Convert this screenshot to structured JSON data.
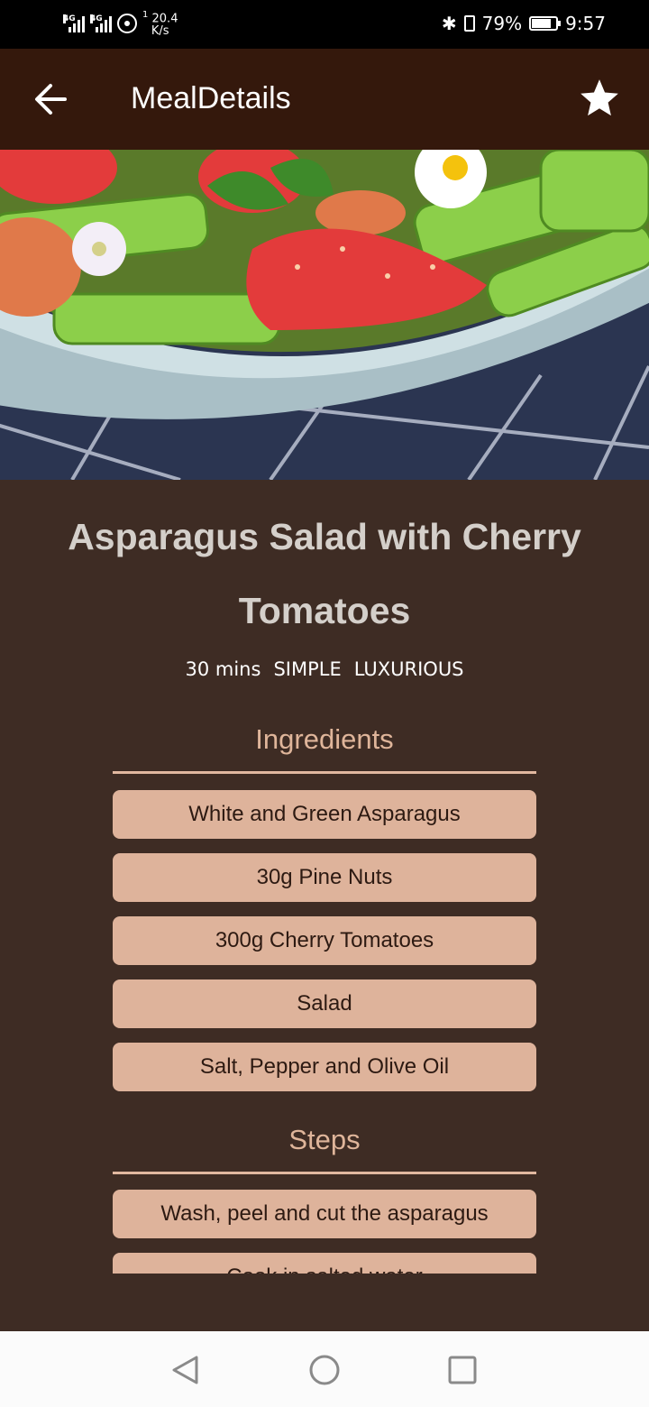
{
  "status_bar": {
    "network_1": "4G",
    "network_2": "4G",
    "speed_value": "20.4",
    "speed_unit": "K/s",
    "speed_prefix": "1",
    "battery": "79%",
    "time": "9:57",
    "battery_level": 0.79,
    "icons": [
      "signal-icon",
      "hotspot-icon",
      "bluetooth-icon",
      "vibrate-icon",
      "battery-icon"
    ]
  },
  "app_bar": {
    "title": "MealDetails",
    "back_icon": "arrow-back-icon",
    "favorite_icon": "star-icon"
  },
  "meal": {
    "title_line1": "Asparagus Salad with Cherry",
    "title_line2": "Tomatoes",
    "duration": "30 mins",
    "complexity": "SIMPLE",
    "affordability": "LUXURIOUS"
  },
  "ingredients": {
    "heading": "Ingredients",
    "items": [
      "White and Green Asparagus",
      "30g Pine Nuts",
      "300g Cherry Tomatoes",
      "Salad",
      "Salt, Pepper and Olive Oil"
    ]
  },
  "steps": {
    "heading": "Steps",
    "items": [
      "Wash, peel and cut the asparagus",
      "Cook in salted water"
    ]
  },
  "nav_bar": {
    "icons": [
      "back-triangle-icon",
      "home-circle-icon",
      "recents-square-icon"
    ]
  },
  "colors": {
    "app_bar": "#34180c",
    "background": "#3e2c24",
    "pill": "#deb39b",
    "accent_text": "#dfb59a"
  }
}
